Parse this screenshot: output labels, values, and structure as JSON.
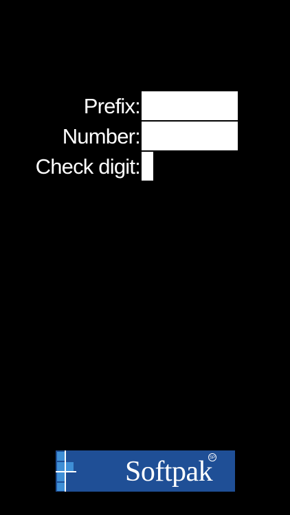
{
  "form": {
    "prefix": {
      "label": "Prefix:",
      "value": ""
    },
    "number": {
      "label": "Number:",
      "value": ""
    },
    "check_digit": {
      "label": "Check digit:",
      "value": ""
    }
  },
  "brand": {
    "name": "Softpak",
    "registered_mark": "SP",
    "colors": {
      "background": "#1f4f96",
      "grid_light": "#3f8fd6",
      "text": "#ffffff"
    }
  },
  "theme": {
    "background": "#000000",
    "label_color": "#ffffff",
    "input_color": "#ffffff"
  }
}
